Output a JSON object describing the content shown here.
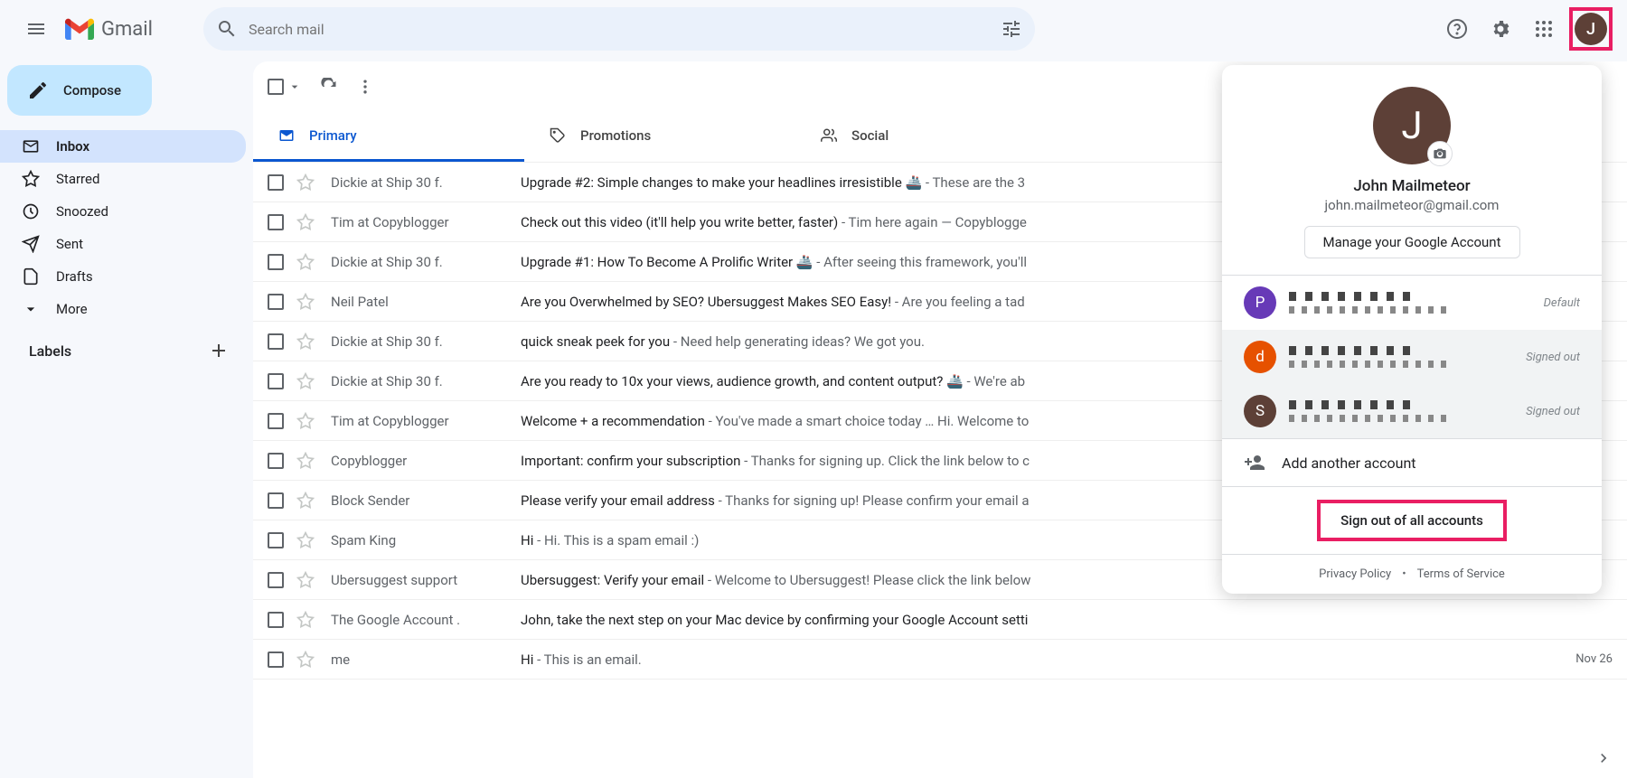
{
  "header": {
    "brand": "Gmail",
    "search_placeholder": "Search mail"
  },
  "compose_label": "Compose",
  "sidebar": {
    "items": [
      {
        "label": "Inbox"
      },
      {
        "label": "Starred"
      },
      {
        "label": "Snoozed"
      },
      {
        "label": "Sent"
      },
      {
        "label": "Drafts"
      },
      {
        "label": "More"
      }
    ],
    "labels_heading": "Labels"
  },
  "tabs": [
    {
      "label": "Primary"
    },
    {
      "label": "Promotions"
    },
    {
      "label": "Social"
    }
  ],
  "emails": [
    {
      "sender": "Dickie at Ship 30 f.",
      "subject": "Upgrade #2: Simple changes to make your headlines irresistible 🚢",
      "snippet": " - These are the 3",
      "date": ""
    },
    {
      "sender": "Tim at Copyblogger",
      "subject": "Check out this video (it'll help you write better, faster)",
      "snippet": " - Tim here again — Copyblogge",
      "date": ""
    },
    {
      "sender": "Dickie at Ship 30 f.",
      "subject": "Upgrade #1: How To Become A Prolific Writer 🚢",
      "snippet": " - After seeing this framework, you'll",
      "date": ""
    },
    {
      "sender": "Neil Patel",
      "subject": "Are you Overwhelmed by SEO? Ubersuggest Makes SEO Easy!",
      "snippet": " - Are you feeling a tad",
      "date": ""
    },
    {
      "sender": "Dickie at Ship 30 f.",
      "subject": "quick sneak peek for you",
      "snippet": " - Need help generating ideas? We got you.",
      "date": ""
    },
    {
      "sender": "Dickie at Ship 30 f.",
      "subject": "Are you ready to 10x your views, audience growth, and content output? 🚢",
      "snippet": " - We're ab",
      "date": ""
    },
    {
      "sender": "Tim at Copyblogger",
      "subject": "Welcome + a recommendation",
      "snippet": " - You've made a smart choice today … Hi. Welcome to",
      "date": ""
    },
    {
      "sender": "Copyblogger",
      "subject": "Important: confirm your subscription",
      "snippet": " - Thanks for signing up. Click the link below to c",
      "date": ""
    },
    {
      "sender": "Block Sender",
      "subject": "Please verify your email address",
      "snippet": " - Thanks for signing up! Please confirm your email a",
      "date": ""
    },
    {
      "sender": "Spam King",
      "subject": "Hi",
      "snippet": " - Hi. This is a spam email :)",
      "date": ""
    },
    {
      "sender": "Ubersuggest support",
      "subject": "Ubersuggest: Verify your email",
      "snippet": " - Welcome to Ubersuggest! Please click the link below",
      "date": ""
    },
    {
      "sender": "The Google Account .",
      "subject": "John, take the next step on your Mac device by confirming your Google Account setti",
      "snippet": "",
      "date": ""
    },
    {
      "sender": "me",
      "subject": "Hi",
      "snippet": " - This is an email.",
      "date": "Nov 26"
    }
  ],
  "account_popup": {
    "avatar_initial": "J",
    "name": "John Mailmeteor",
    "email": "john.mailmeteor@gmail.com",
    "manage_label": "Manage your Google Account",
    "accounts": [
      {
        "initial": "P",
        "color": "#673ab7",
        "status": "Default"
      },
      {
        "initial": "d",
        "color": "#e65100",
        "status": "Signed out"
      },
      {
        "initial": "S",
        "color": "#5d4037",
        "status": "Signed out"
      }
    ],
    "add_label": "Add another account",
    "signout_label": "Sign out of all accounts",
    "privacy_label": "Privacy Policy",
    "dot": "•",
    "terms_label": "Terms of Service"
  }
}
